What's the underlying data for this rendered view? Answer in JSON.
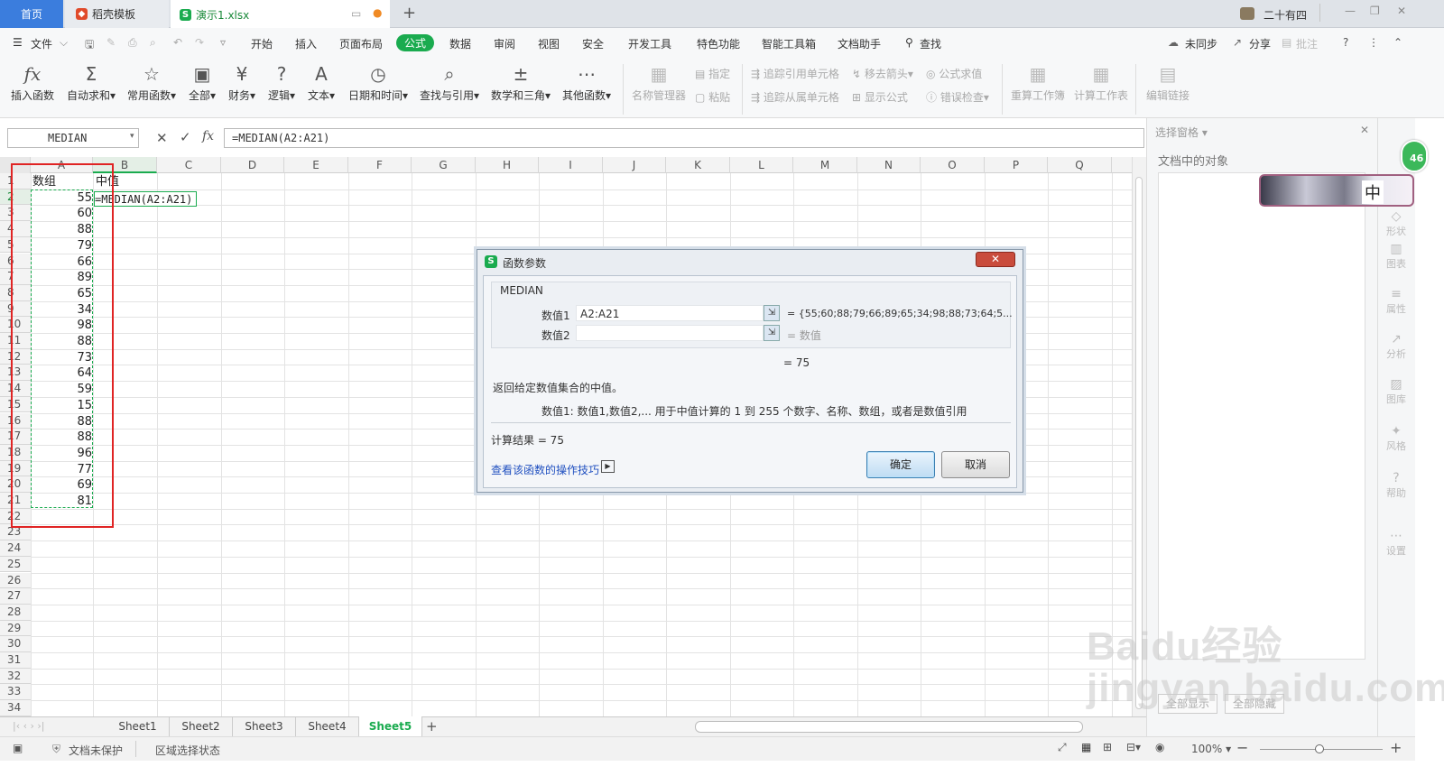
{
  "tabs": {
    "home": "首页",
    "template": "稻壳模板",
    "file": "演示1.xlsx",
    "add": "+"
  },
  "window": {
    "user": "二十有四"
  },
  "menu": {
    "file": "文件",
    "items": [
      "开始",
      "插入",
      "页面布局",
      "公式",
      "数据",
      "审阅",
      "视图",
      "安全",
      "开发工具",
      "特色功能",
      "智能工具箱",
      "文档助手",
      "查找"
    ],
    "sync": "未同步",
    "share": "分享",
    "comment": "批注"
  },
  "ribbon": {
    "insert_func": "插入函数",
    "autosum": "自动求和",
    "common": "常用函数",
    "all": "全部",
    "finance": "财务",
    "logic": "逻辑",
    "text": "文本",
    "datetime": "日期和时间",
    "lookup": "查找与引用",
    "math": "数学和三角",
    "other": "其他函数",
    "name_mgr": "名称管理器",
    "define": "指定",
    "paste": "粘贴",
    "trace_pre": "追踪引用单元格",
    "trace_dep": "追踪从属单元格",
    "remove_arrows": "移去箭头",
    "show_formula": "显示公式",
    "eval": "公式求值",
    "err_check": "错误检查",
    "recalc_book": "重算工作簿",
    "calc_sheet": "计算工作表",
    "edit_links": "编辑链接"
  },
  "formula_bar": {
    "name_box": "MEDIAN",
    "formula": "=MEDIAN(A2:A21)"
  },
  "grid": {
    "columns": [
      "A",
      "B",
      "C",
      "D",
      "E",
      "F",
      "G",
      "H",
      "I",
      "J",
      "K",
      "L",
      "M",
      "N",
      "O",
      "P",
      "Q"
    ],
    "rows": [
      "1",
      "2",
      "3",
      "4",
      "5",
      "6",
      "7",
      "8",
      "9",
      "10",
      "11",
      "12",
      "13",
      "14",
      "15",
      "16",
      "17",
      "18",
      "19",
      "20",
      "21",
      "22",
      "23",
      "24",
      "25",
      "26",
      "27",
      "28",
      "29",
      "30",
      "31",
      "32",
      "33",
      "34"
    ],
    "a1": "数组",
    "b1": "中值",
    "b2": "=MEDIAN(A2:A21)",
    "values": [
      "55",
      "60",
      "88",
      "79",
      "66",
      "89",
      "65",
      "34",
      "98",
      "88",
      "73",
      "64",
      "59",
      "15",
      "88",
      "88",
      "96",
      "77",
      "69",
      "81"
    ]
  },
  "sheets": [
    "Sheet1",
    "Sheet2",
    "Sheet3",
    "Sheet4",
    "Sheet5"
  ],
  "active_sheet": "Sheet5",
  "right_pane": {
    "title": "选择窗格",
    "objects": "文档中的对象",
    "badge": "46",
    "avatar_char": "中",
    "show_all": "全部显示",
    "hide_all": "全部隐藏",
    "sidebar": [
      "形状",
      "图表",
      "属性",
      "分析",
      "图库",
      "风格",
      "帮助",
      "设置"
    ]
  },
  "dialog": {
    "title": "函数参数",
    "func": "MEDIAN",
    "arg1_label": "数值1",
    "arg1_value": "A2:A21",
    "arg1_result": "= {55;60;88;79;66;89;65;34;98;88;73;64;5...",
    "arg2_label": "数值2",
    "arg2_result": "= 数值",
    "mid_result": "= 75",
    "description": "返回给定数值集合的中值。",
    "arg_help": "数值1:  数值1,数值2,... 用于中值计算的 1 到 255 个数字、名称、数组，或者是数值引用",
    "calc_result": "计算结果  =  75",
    "tips_link": "查看该函数的操作技巧",
    "ok": "确定",
    "cancel": "取消"
  },
  "status": {
    "protect": "文档未保护",
    "mode": "区域选择状态",
    "zoom": "100%"
  },
  "watermark": "Baidu经验 jingyan.baidu.com",
  "colors": {
    "accent_green": "#1aab4f",
    "home_tab": "#3b7ddd",
    "highlight_red": "#e02424"
  }
}
